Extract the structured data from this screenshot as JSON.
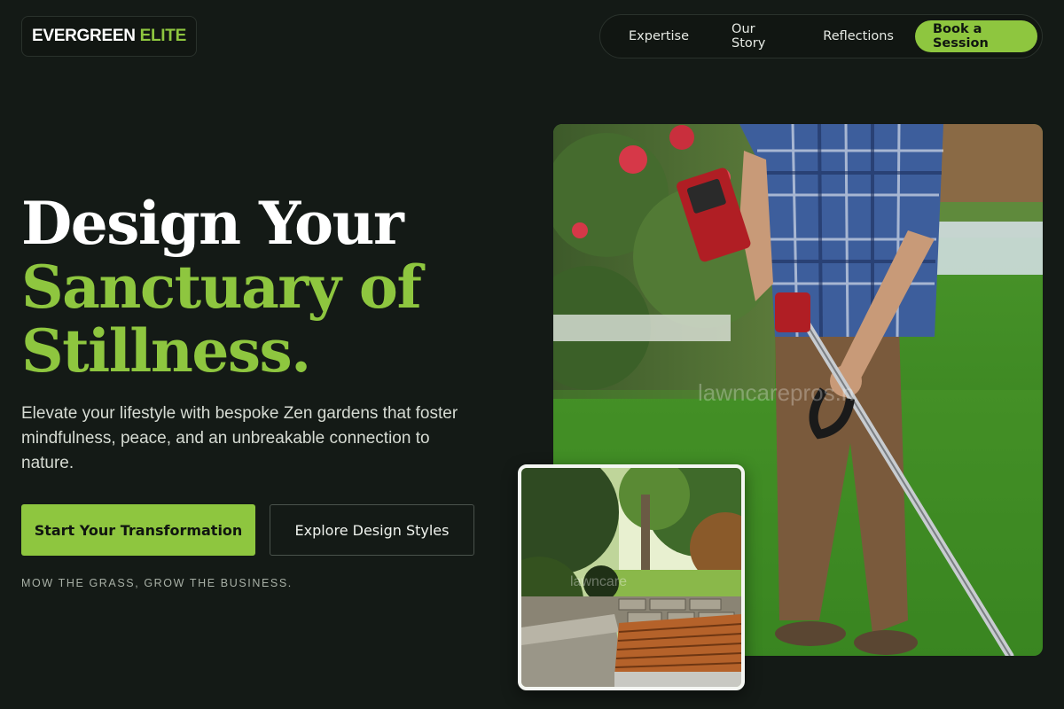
{
  "brand": {
    "name_part1": "EVERGREEN",
    "name_part2": "ELITE"
  },
  "nav": {
    "links": [
      "Expertise",
      "Our Story",
      "Reflections"
    ],
    "cta": "Book a Session"
  },
  "hero": {
    "headline_line1": "Design Your",
    "headline_line2": "Sanctuary of",
    "headline_line3": "Stillness.",
    "lead": "Elevate your lifestyle with bespoke Zen gardens that foster mindfulness, peace, and an unbreakable connection to nature.",
    "primary_button": "Start Your Transformation",
    "secondary_button": "Explore Design Styles",
    "tagline": "MOW THE GRASS, GROW THE BUSINESS."
  },
  "images": {
    "main_watermark": "lawncarepros.n",
    "inset_watermark": "lawncare"
  },
  "colors": {
    "background": "#141a16",
    "accent": "#8ec63f",
    "text": "#ffffff"
  }
}
